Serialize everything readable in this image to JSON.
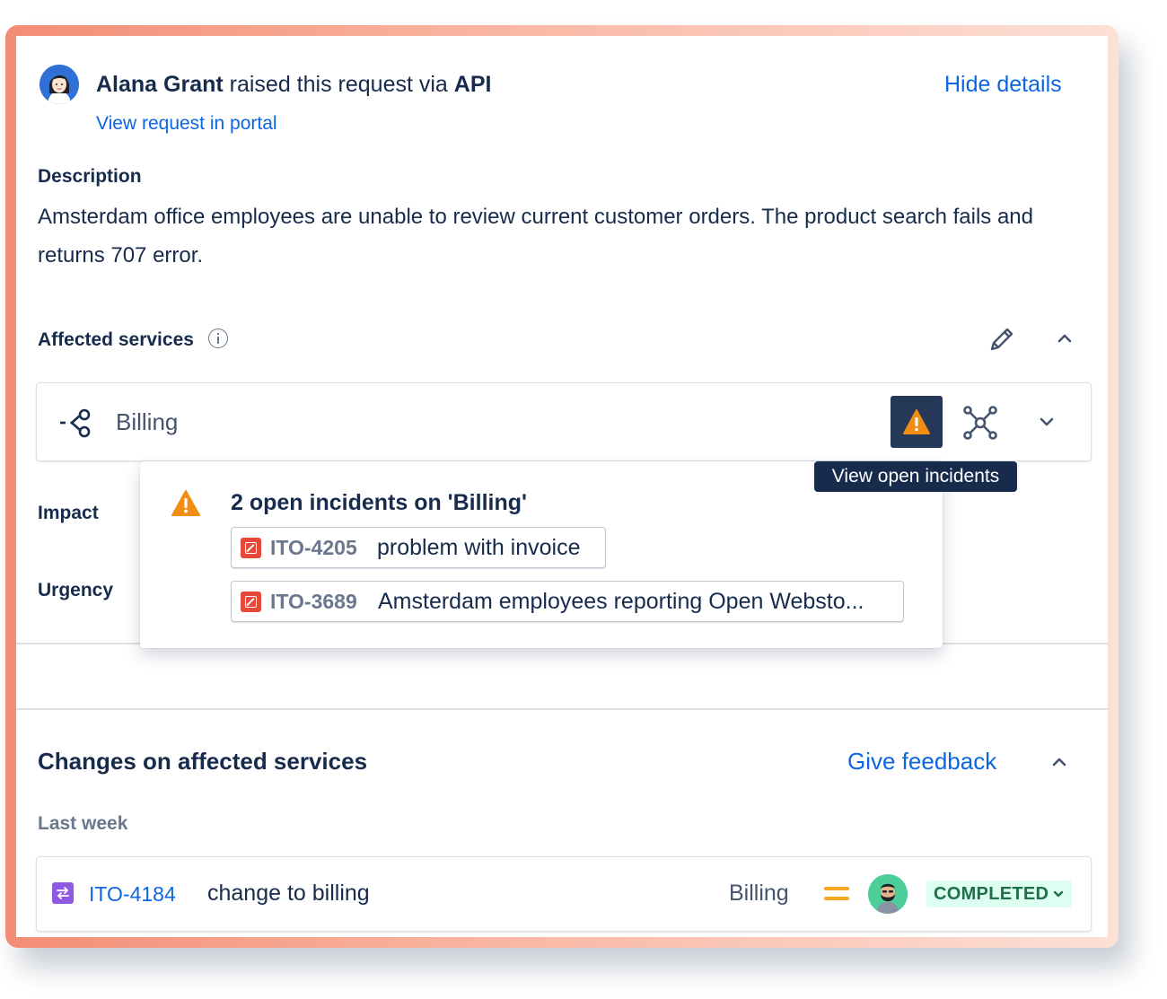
{
  "header": {
    "reporter_name": "Alana Grant",
    "raised_text": " raised this request via ",
    "channel": "API",
    "view_portal_label": "View request in portal",
    "hide_details_label": "Hide details"
  },
  "description": {
    "label": "Description",
    "text": "Amsterdam office employees are unable to review current customer orders. The product search fails and returns 707 error."
  },
  "affected_services": {
    "label": "Affected services",
    "services": [
      {
        "name": "Billing"
      }
    ],
    "tooltip": "View open incidents"
  },
  "incidents_popup": {
    "title": "2 open incidents on 'Billing'",
    "incidents": [
      {
        "key": "ITO-4205",
        "summary": "problem with invoice"
      },
      {
        "key": "ITO-3689",
        "summary": "Amsterdam employees reporting Open Websto..."
      }
    ]
  },
  "fields": {
    "impact_label": "Impact",
    "urgency_label": "Urgency"
  },
  "changes": {
    "title": "Changes on affected services",
    "give_feedback_label": "Give feedback",
    "group_label": "Last week",
    "items": [
      {
        "key": "ITO-4184",
        "summary": "change to billing",
        "service": "Billing",
        "priority": "medium",
        "status": "COMPLETED"
      }
    ]
  },
  "colors": {
    "link": "#0c66e4",
    "warning": "#f18d13",
    "incident_icon": "#e5493a",
    "change_icon": "#8f5ae3",
    "status_bg": "#dcfff1",
    "status_text": "#216e4e",
    "priority": "#f5a623"
  },
  "icons": {
    "info": "info-circle-icon",
    "edit": "pencil-icon",
    "service": "service-icon",
    "warning": "warning-triangle-icon",
    "dependencies": "network-icon",
    "incident": "incident-icon",
    "change": "change-icon",
    "priority": "priority-medium-icon"
  }
}
